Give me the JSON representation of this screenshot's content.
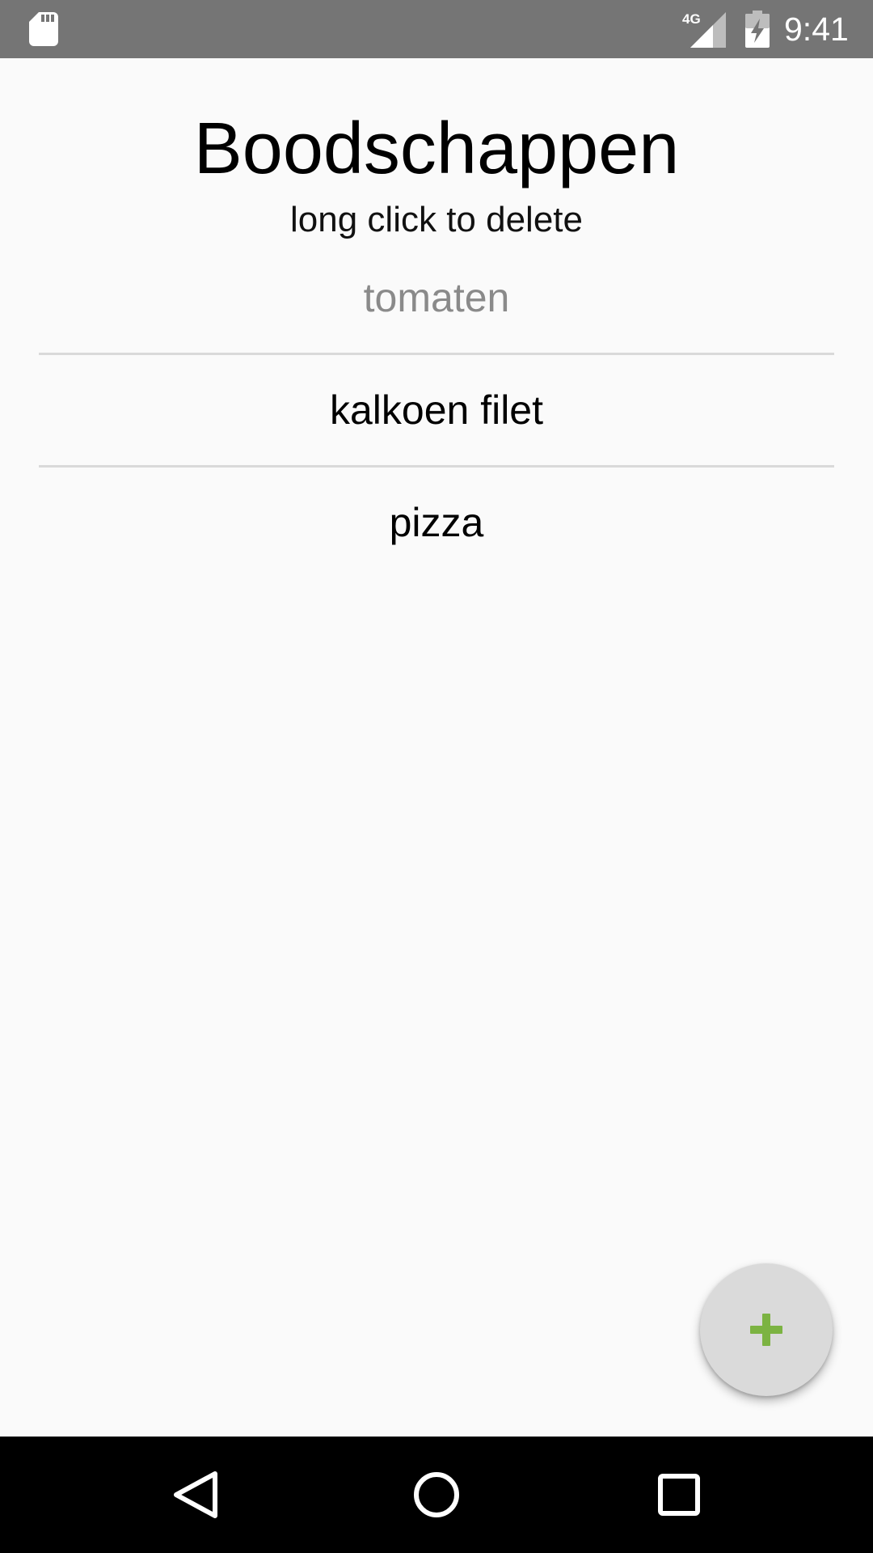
{
  "status_bar": {
    "time": "9:41",
    "network": "4G",
    "icons": [
      "sd-card-icon",
      "cell-signal-icon",
      "battery-charging-icon"
    ]
  },
  "header": {
    "title": "Boodschappen",
    "subtitle": "long click to delete"
  },
  "list": {
    "items": [
      {
        "label": "tomaten",
        "state": "hint"
      },
      {
        "label": "kalkoen filet",
        "state": "normal"
      },
      {
        "label": "pizza",
        "state": "normal"
      }
    ]
  },
  "fab": {
    "icon": "plus-icon",
    "icon_color": "#7cb342"
  },
  "nav_bar": {
    "buttons": [
      "back-icon",
      "home-icon",
      "recents-icon"
    ]
  },
  "colors": {
    "status_bar": "#757575",
    "background": "#fafafa",
    "divider": "#d9d9d9",
    "hint_text": "#8a8a8a",
    "fab_background": "#dadada",
    "nav_bar": "#000000"
  }
}
